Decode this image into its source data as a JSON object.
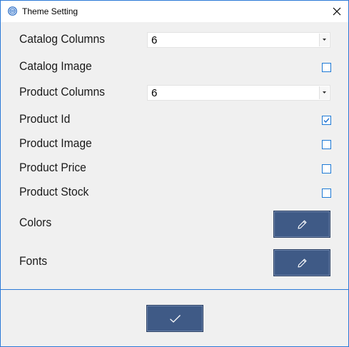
{
  "window": {
    "title": "Theme Setting",
    "close_label": "close"
  },
  "settings": {
    "catalog_columns": {
      "label": "Catalog Columns",
      "value": "6"
    },
    "catalog_image": {
      "label": "Catalog Image",
      "checked": false
    },
    "product_columns": {
      "label": "Product Columns",
      "value": "6"
    },
    "product_id": {
      "label": "Product Id",
      "checked": true
    },
    "product_image": {
      "label": "Product Image",
      "checked": false
    },
    "product_price": {
      "label": "Product Price",
      "checked": false
    },
    "product_stock": {
      "label": "Product Stock",
      "checked": false
    },
    "colors": {
      "label": "Colors",
      "button_icon": "pencil-icon"
    },
    "fonts": {
      "label": "Fonts",
      "button_icon": "pencil-icon"
    }
  },
  "footer": {
    "ok_icon": "checkmark-icon"
  },
  "colors": {
    "accent": "#2b79d7",
    "button": "#3f5a86",
    "background": "#f0f0f0"
  }
}
